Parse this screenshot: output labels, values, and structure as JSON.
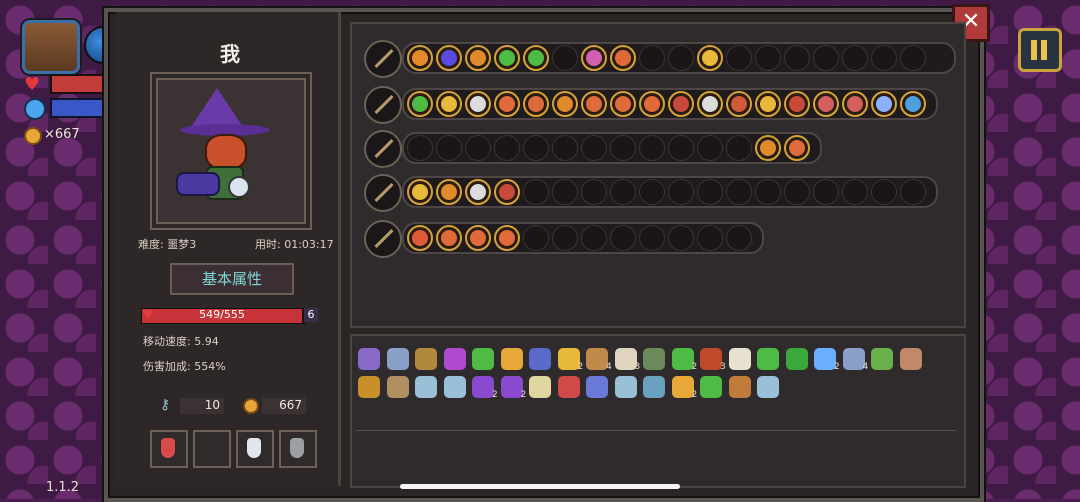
{
  "hud": {
    "coins_label": "×667",
    "version": "1.1.2"
  },
  "panel": {
    "close_label": "✕",
    "player_name": "我",
    "difficulty": "难度: 噩梦3",
    "time": "用时: 01:03:17",
    "attr_title": "基本属性",
    "hp": {
      "text": "549/555",
      "current": 549,
      "max": 555,
      "shield": "6"
    },
    "move_speed": "移动速度: 5.94",
    "damage_bonus": "伤害加成: 554%",
    "keys": "10",
    "gold": "667"
  },
  "consumables": [
    {
      "name": "red-potion",
      "color": "#d94b4b"
    },
    {
      "name": "empty",
      "color": ""
    },
    {
      "name": "white-potion",
      "color": "#dfe6ee"
    },
    {
      "name": "grey-bottle",
      "color": "#9aa0a6"
    }
  ],
  "wands": [
    {
      "slots": 20,
      "filled_colors": [
        "#e58a2c",
        "#5a4ae0",
        "#e08a2c",
        "#4dbb44",
        "#4dbb44",
        "#d35fb0",
        "#e06a3a",
        "#e8b83a"
      ],
      "filled_idx": [
        0,
        1,
        2,
        3,
        4,
        6,
        7,
        10
      ]
    },
    {
      "slots": 18,
      "filled_colors": [
        "#4dbb44",
        "#e8b83a",
        "#dcdcdc",
        "#e06a3a",
        "#e06a3a",
        "#e08a2c",
        "#e06a3a",
        "#e06a3a",
        "#e06a3a",
        "#c94a3a",
        "#dcdcdc",
        "#d05a3a",
        "#e8b83a",
        "#c94a3a",
        "#d35f5f",
        "#d35f5f",
        "#8ab0ff",
        "#4aa0e0",
        "#e8b83a"
      ],
      "filled_idx": [
        0,
        1,
        2,
        3,
        4,
        5,
        6,
        7,
        8,
        9,
        10,
        11,
        12,
        13,
        14,
        15,
        16,
        17
      ]
    },
    {
      "slots": 14,
      "filled_colors": [
        "#e08a2c",
        "#e06a3a"
      ],
      "filled_idx": [
        12,
        13
      ]
    },
    {
      "slots": 18,
      "filled_colors": [
        "#e8b83a",
        "#e08a2c",
        "#dcdcdc",
        "#c94a3a"
      ],
      "filled_idx": [
        0,
        1,
        2,
        3
      ]
    },
    {
      "slots": 12,
      "filled_colors": [
        "#e05a3a",
        "#e06a3a",
        "#e06a3a",
        "#e06a3a"
      ],
      "filled_idx": [
        0,
        1,
        2,
        3
      ]
    }
  ],
  "items_row1": [
    {
      "c": "#8a6ac8",
      "n": ""
    },
    {
      "c": "#8aa0c8",
      "n": ""
    },
    {
      "c": "#b08a3a",
      "n": ""
    },
    {
      "c": "#b04ad0",
      "n": ""
    },
    {
      "c": "#4dbb44",
      "n": ""
    },
    {
      "c": "#e8a83a",
      "n": ""
    },
    {
      "c": "#5a6ac8",
      "n": ""
    },
    {
      "c": "#e8b83a",
      "n": "2"
    },
    {
      "c": "#c08a4a",
      "n": "4"
    },
    {
      "c": "#e0d6c0",
      "n": "3"
    },
    {
      "c": "#6a8a5a",
      "n": ""
    },
    {
      "c": "#4dbb44",
      "n": "2"
    },
    {
      "c": "#c04a2a",
      "n": "3"
    },
    {
      "c": "#e8e0d0",
      "n": ""
    },
    {
      "c": "#4dbb44",
      "n": ""
    },
    {
      "c": "#3aa83a",
      "n": ""
    },
    {
      "c": "#6ab0ff",
      "n": "2"
    },
    {
      "c": "#8aa0c8",
      "n": "4"
    },
    {
      "c": "#6ab04a",
      "n": ""
    },
    {
      "c": "#c08a6a",
      "n": ""
    }
  ],
  "items_row2": [
    {
      "c": "#c8902a",
      "n": ""
    },
    {
      "c": "#b09060",
      "n": ""
    },
    {
      "c": "#9ac0d8",
      "n": ""
    },
    {
      "c": "#9ac0d8",
      "n": ""
    },
    {
      "c": "#8a4ad0",
      "n": "2"
    },
    {
      "c": "#8a4ad0",
      "n": "2"
    },
    {
      "c": "#e0d6a0",
      "n": ""
    },
    {
      "c": "#d04a4a",
      "n": ""
    },
    {
      "c": "#6a7ad8",
      "n": ""
    },
    {
      "c": "#9ac0d8",
      "n": ""
    },
    {
      "c": "#6aa0c0",
      "n": ""
    },
    {
      "c": "#e8a83a",
      "n": "2"
    },
    {
      "c": "#4dbb44",
      "n": ""
    },
    {
      "c": "#c07a3a",
      "n": ""
    },
    {
      "c": "#9ac0d8",
      "n": ""
    }
  ]
}
